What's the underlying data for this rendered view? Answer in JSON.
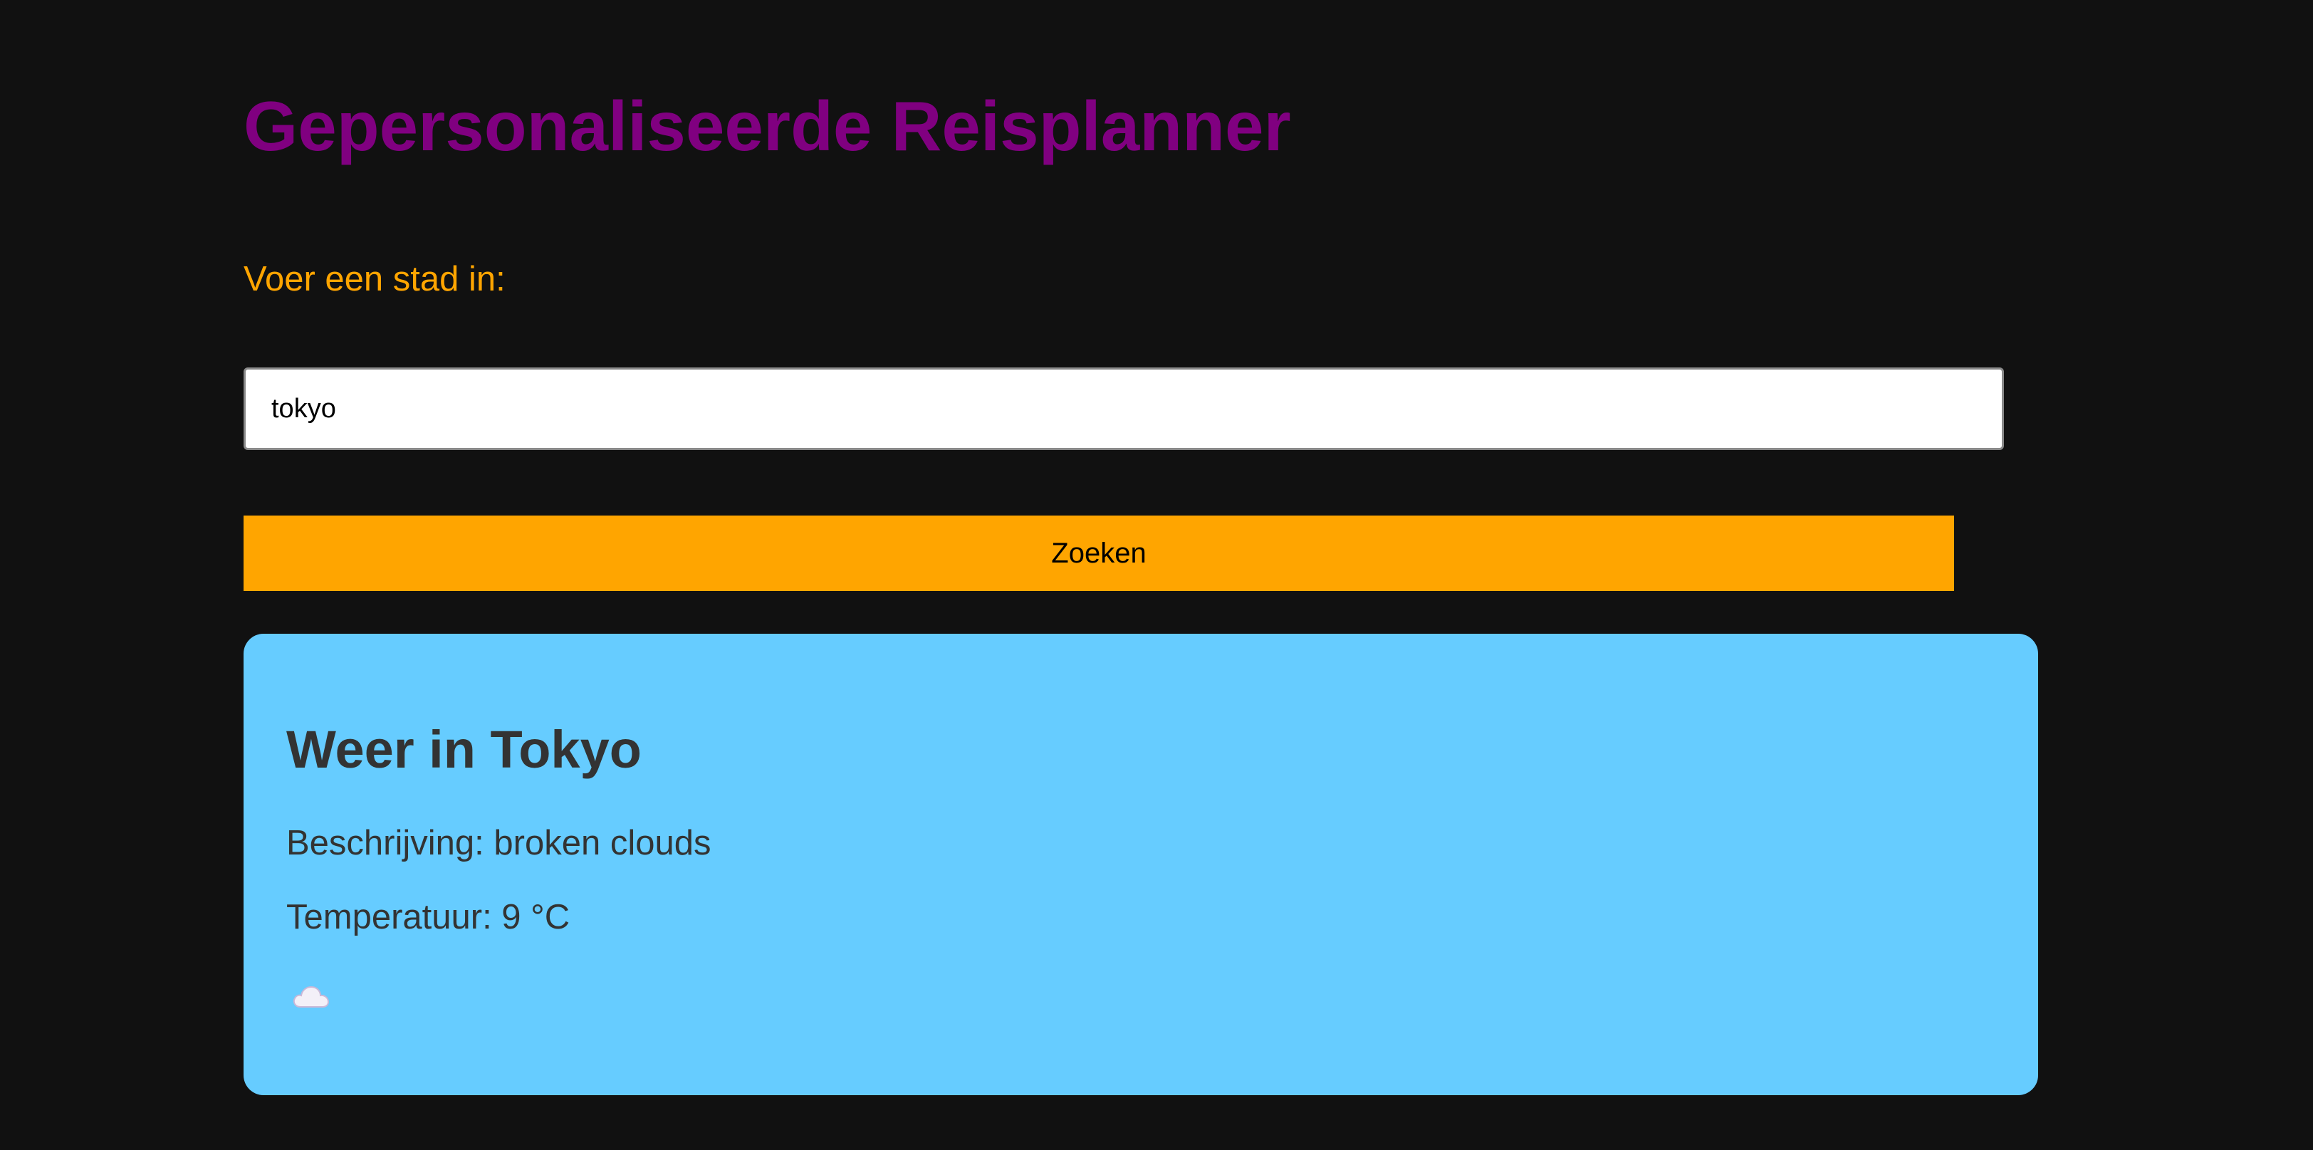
{
  "header": {
    "title": "Gepersonaliseerde Reisplanner",
    "title_color": "#800080"
  },
  "search": {
    "label": "Voer een stad in:",
    "value": "tokyo",
    "button_label": "Zoeken",
    "accent_color": "#FFA500"
  },
  "weather": {
    "title": "Weer in Tokyo",
    "description": "Beschrijving: broken clouds",
    "temperature": "Temperatuur: 9 °C",
    "icon": "cloud-icon",
    "card_color": "#66CCFF"
  },
  "page": {
    "background_color": "#111111"
  }
}
